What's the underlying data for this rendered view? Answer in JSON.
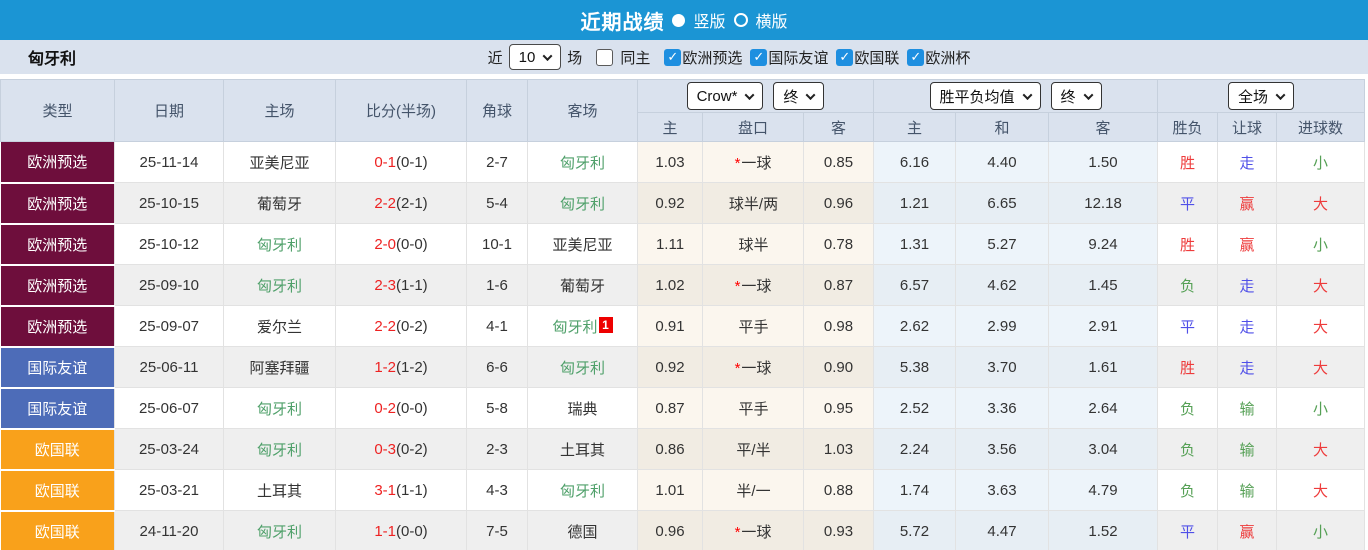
{
  "titlebar": {
    "title": "近期战绩",
    "vertical_label": "竖版",
    "horizontal_label": "横版"
  },
  "filter": {
    "team": "匈牙利",
    "near_label": "近",
    "count_value": "10",
    "games_label": "场",
    "same_home_label": "同主",
    "same_home_checked": false,
    "competitions": [
      {
        "label": "欧洲预选",
        "checked": true
      },
      {
        "label": "国际友谊",
        "checked": true
      },
      {
        "label": "欧国联",
        "checked": true
      },
      {
        "label": "欧洲杯",
        "checked": true
      }
    ]
  },
  "table": {
    "static_headers": [
      "类型",
      "日期",
      "主场",
      "比分(半场)",
      "角球",
      "客场"
    ],
    "dropdowns": {
      "odds_source": "Crow*",
      "odds_time": "终",
      "avg_type": "胜平负均值",
      "avg_time": "终",
      "scope": "全场"
    },
    "sub_headers": [
      "主",
      "盘口",
      "客",
      "主",
      "和",
      "客",
      "胜负",
      "让球",
      "进球数"
    ],
    "rows": [
      {
        "type": "欧洲预选",
        "type_color": "type_euro_qualifier",
        "date": "25-11-14",
        "home": "亚美尼亚",
        "home_hl": false,
        "score": "0-1",
        "half": "(0-1)",
        "corners": "2-7",
        "away": "匈牙利",
        "away_hl": true,
        "away_badge": "",
        "odds_home": "1.03",
        "handicap_star": true,
        "handicap": "一球",
        "odds_away": "0.85",
        "avg_home": "6.16",
        "avg_draw": "4.40",
        "avg_away": "1.50",
        "result": "胜",
        "result_color": "win_red",
        "handicap_result": "走",
        "handicap_result_color": "draw_blue",
        "goals": "小",
        "goals_color": "loss_green"
      },
      {
        "type": "欧洲预选",
        "type_color": "type_euro_qualifier",
        "date": "25-10-15",
        "home": "葡萄牙",
        "home_hl": false,
        "score": "2-2",
        "half": "(2-1)",
        "corners": "5-4",
        "away": "匈牙利",
        "away_hl": true,
        "away_badge": "",
        "odds_home": "0.92",
        "handicap_star": false,
        "handicap": "球半/两",
        "odds_away": "0.96",
        "avg_home": "1.21",
        "avg_draw": "6.65",
        "avg_away": "12.18",
        "result": "平",
        "result_color": "draw_blue",
        "handicap_result": "赢",
        "handicap_result_color": "win_red",
        "goals": "大",
        "goals_color": "win_red"
      },
      {
        "type": "欧洲预选",
        "type_color": "type_euro_qualifier",
        "date": "25-10-12",
        "home": "匈牙利",
        "home_hl": true,
        "score": "2-0",
        "half": "(0-0)",
        "corners": "10-1",
        "away": "亚美尼亚",
        "away_hl": false,
        "away_badge": "",
        "odds_home": "1.11",
        "handicap_star": false,
        "handicap": "球半",
        "odds_away": "0.78",
        "avg_home": "1.31",
        "avg_draw": "5.27",
        "avg_away": "9.24",
        "result": "胜",
        "result_color": "win_red",
        "handicap_result": "赢",
        "handicap_result_color": "win_red",
        "goals": "小",
        "goals_color": "loss_green"
      },
      {
        "type": "欧洲预选",
        "type_color": "type_euro_qualifier",
        "date": "25-09-10",
        "home": "匈牙利",
        "home_hl": true,
        "score": "2-3",
        "half": "(1-1)",
        "corners": "1-6",
        "away": "葡萄牙",
        "away_hl": false,
        "away_badge": "",
        "odds_home": "1.02",
        "handicap_star": true,
        "handicap": "一球",
        "odds_away": "0.87",
        "avg_home": "6.57",
        "avg_draw": "4.62",
        "avg_away": "1.45",
        "result": "负",
        "result_color": "loss_green",
        "handicap_result": "走",
        "handicap_result_color": "draw_blue",
        "goals": "大",
        "goals_color": "win_red"
      },
      {
        "type": "欧洲预选",
        "type_color": "type_euro_qualifier",
        "date": "25-09-07",
        "home": "爱尔兰",
        "home_hl": false,
        "score": "2-2",
        "half": "(0-2)",
        "corners": "4-1",
        "away": "匈牙利",
        "away_hl": true,
        "away_badge": "1",
        "odds_home": "0.91",
        "handicap_star": false,
        "handicap": "平手",
        "odds_away": "0.98",
        "avg_home": "2.62",
        "avg_draw": "2.99",
        "avg_away": "2.91",
        "result": "平",
        "result_color": "draw_blue",
        "handicap_result": "走",
        "handicap_result_color": "draw_blue",
        "goals": "大",
        "goals_color": "win_red"
      },
      {
        "type": "国际友谊",
        "type_color": "type_friendly",
        "date": "25-06-11",
        "home": "阿塞拜疆",
        "home_hl": false,
        "score": "1-2",
        "half": "(1-2)",
        "corners": "6-6",
        "away": "匈牙利",
        "away_hl": true,
        "away_badge": "",
        "odds_home": "0.92",
        "handicap_star": true,
        "handicap": "一球",
        "odds_away": "0.90",
        "avg_home": "5.38",
        "avg_draw": "3.70",
        "avg_away": "1.61",
        "result": "胜",
        "result_color": "win_red",
        "handicap_result": "走",
        "handicap_result_color": "draw_blue",
        "goals": "大",
        "goals_color": "win_red"
      },
      {
        "type": "国际友谊",
        "type_color": "type_friendly",
        "date": "25-06-07",
        "home": "匈牙利",
        "home_hl": true,
        "score": "0-2",
        "half": "(0-0)",
        "corners": "5-8",
        "away": "瑞典",
        "away_hl": false,
        "away_badge": "",
        "odds_home": "0.87",
        "handicap_star": false,
        "handicap": "平手",
        "odds_away": "0.95",
        "avg_home": "2.52",
        "avg_draw": "3.36",
        "avg_away": "2.64",
        "result": "负",
        "result_color": "loss_green",
        "handicap_result": "输",
        "handicap_result_color": "loss_green",
        "goals": "小",
        "goals_color": "loss_green"
      },
      {
        "type": "欧国联",
        "type_color": "type_nations_league",
        "date": "25-03-24",
        "home": "匈牙利",
        "home_hl": true,
        "score": "0-3",
        "half": "(0-2)",
        "corners": "2-3",
        "away": "土耳其",
        "away_hl": false,
        "away_badge": "",
        "odds_home": "0.86",
        "handicap_star": false,
        "handicap": "平/半",
        "odds_away": "1.03",
        "avg_home": "2.24",
        "avg_draw": "3.56",
        "avg_away": "3.04",
        "result": "负",
        "result_color": "loss_green",
        "handicap_result": "输",
        "handicap_result_color": "loss_green",
        "goals": "大",
        "goals_color": "win_red"
      },
      {
        "type": "欧国联",
        "type_color": "type_nations_league",
        "date": "25-03-21",
        "home": "土耳其",
        "home_hl": false,
        "score": "3-1",
        "half": "(1-1)",
        "corners": "4-3",
        "away": "匈牙利",
        "away_hl": true,
        "away_badge": "",
        "odds_home": "1.01",
        "handicap_star": false,
        "handicap": "半/一",
        "odds_away": "0.88",
        "avg_home": "1.74",
        "avg_draw": "3.63",
        "avg_away": "4.79",
        "result": "负",
        "result_color": "loss_green",
        "handicap_result": "输",
        "handicap_result_color": "loss_green",
        "goals": "大",
        "goals_color": "win_red"
      },
      {
        "type": "欧国联",
        "type_color": "type_nations_league",
        "date": "24-11-20",
        "home": "匈牙利",
        "home_hl": true,
        "score": "1-1",
        "half": "(0-0)",
        "corners": "7-5",
        "away": "德国",
        "away_hl": false,
        "away_badge": "",
        "odds_home": "0.96",
        "handicap_star": true,
        "handicap": "一球",
        "odds_away": "0.93",
        "avg_home": "5.72",
        "avg_draw": "4.47",
        "avg_away": "1.52",
        "result": "平",
        "result_color": "draw_blue",
        "handicap_result": "赢",
        "handicap_result_color": "win_red",
        "goals": "小",
        "goals_color": "loss_green"
      }
    ]
  },
  "colors": {
    "topbar_blue": "#1b95d4",
    "panel_bg": "#dae2ee",
    "header_text": "#44546a",
    "type_euro_qualifier": "#6e0e3c",
    "type_friendly": "#4d6cb8",
    "type_nations_league": "#f9a11b",
    "team_highlight_green": "#4fa06a",
    "score_red": "#ee2222",
    "win_red": "#ee3b3b",
    "draw_blue": "#5050e8",
    "loss_green": "#55a055",
    "badge_red": "#ee0000",
    "checkbox_blue": "#1e8fe0",
    "odds_col_bg": "#fbf6ee",
    "avg_col_bg": "#edf4fa",
    "alt_row_bg": "#efefef"
  }
}
